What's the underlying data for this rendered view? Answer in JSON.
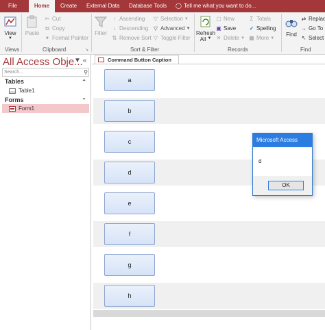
{
  "tabs": [
    {
      "label": "File",
      "active": false
    },
    {
      "label": "Home",
      "active": true
    },
    {
      "label": "Create",
      "active": false
    },
    {
      "label": "External Data",
      "active": false
    },
    {
      "label": "Database Tools",
      "active": false
    }
  ],
  "tell_me": "Tell me what you want to do...",
  "ribbon": {
    "view_label": "View",
    "paste_label": "Paste",
    "cut_label": "Cut",
    "copy_label": "Copy",
    "format_painter_label": "Format Painter",
    "filter_label": "Filter",
    "ascending_label": "Ascending",
    "descending_label": "Descending",
    "remove_sort_label": "Remove Sort",
    "selection_label": "Selection",
    "advanced_label": "Advanced",
    "toggle_filter_label": "Toggle Filter",
    "refresh_label": "Refresh",
    "refresh_all_label": "All",
    "new_label": "New",
    "save_label": "Save",
    "delete_label": "Delete",
    "totals_label": "Totals",
    "spelling_label": "Spelling",
    "more_label": "More",
    "find_label": "Find",
    "replace_label": "Replac",
    "goto_label": "Go To",
    "select_label": "Select",
    "groups": {
      "views": "Views",
      "clipboard": "Clipboard",
      "sort_filter": "Sort & Filter",
      "records": "Records",
      "find": "Find"
    }
  },
  "nav": {
    "title": "All Access Obje...",
    "search_placeholder": "Search...",
    "sections": [
      {
        "label": "Tables",
        "items": [
          "Table1"
        ]
      },
      {
        "label": "Forms",
        "items": [
          "Form1"
        ]
      }
    ]
  },
  "document": {
    "tab_label": "Command Button Caption",
    "buttons": [
      "a",
      "b",
      "c",
      "d",
      "e",
      "f",
      "g",
      "h"
    ]
  },
  "dialog": {
    "title": "Microsoft Access",
    "message": "d",
    "ok_label": "OK"
  },
  "colors": {
    "access_red": "#a4373a",
    "dialog_blue": "#2b7de1",
    "selected_item": "#f4c7cb"
  }
}
